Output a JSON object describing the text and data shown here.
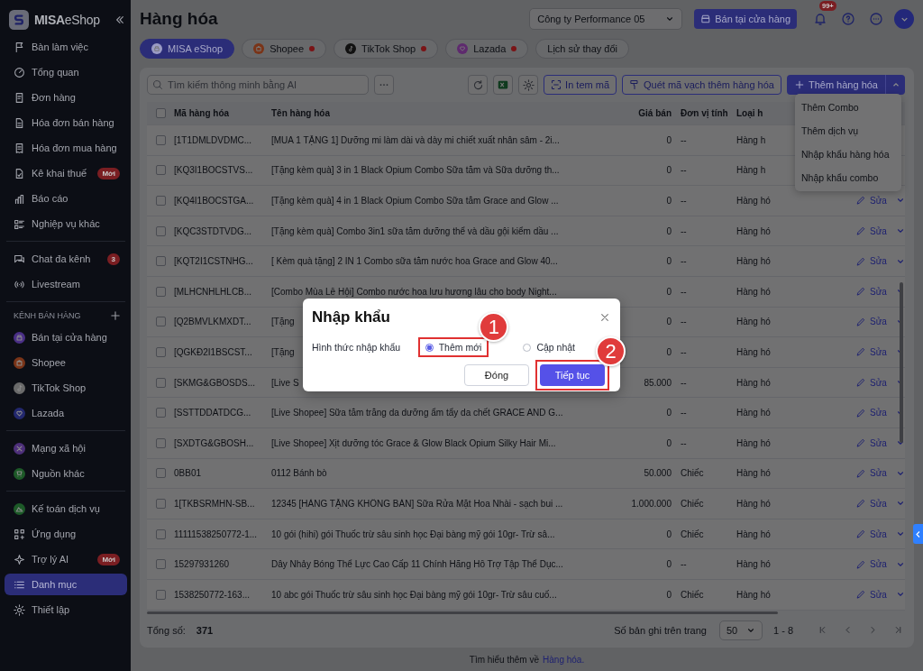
{
  "sidebar": {
    "brand": "MISA",
    "product": "eShop",
    "groups": [
      {
        "items": [
          {
            "label": "Bàn làm việc",
            "selected": false
          },
          {
            "label": "Tổng quan",
            "selected": false
          },
          {
            "label": "Đơn hàng",
            "selected": false
          },
          {
            "label": "Hóa đơn bán hàng",
            "selected": false
          },
          {
            "label": "Hóa đơn mua hàng",
            "selected": false
          },
          {
            "label": "Kê khai thuế",
            "badge": "Mới",
            "selected": false
          },
          {
            "label": "Báo cáo",
            "selected": false
          },
          {
            "label": "Nghiệp vụ khác",
            "selected": false
          }
        ]
      },
      {
        "items": [
          {
            "label": "Chat đa kênh",
            "badge": "3",
            "selected": false
          },
          {
            "label": "Livestream",
            "selected": false
          }
        ]
      },
      {
        "title": "KÊNH BÁN HÀNG",
        "items": [
          {
            "label": "Bán tại cửa hàng",
            "color": "#4a2f86",
            "selected": false
          },
          {
            "label": "Shopee",
            "color": "#7a3418",
            "selected": false
          },
          {
            "label": "TikTok Shop",
            "color": "#6a6a6a",
            "selected": false
          },
          {
            "label": "Lazada",
            "color": "#23286e",
            "selected": false
          }
        ]
      },
      {
        "items": [
          {
            "label": "Mạng xã hội",
            "color": "#4d2f7a",
            "selected": false
          },
          {
            "label": "Nguồn khác",
            "color": "#1d5a28",
            "selected": false
          }
        ]
      },
      {
        "items": [
          {
            "label": "Kế toán dịch vụ",
            "color": "#1d5a28",
            "selected": false
          },
          {
            "label": "Ứng dụng",
            "selected": false
          },
          {
            "label": "Trợ lý AI",
            "badge": "Mới",
            "selected": false
          },
          {
            "label": "Danh mục",
            "selected": true
          },
          {
            "label": "Thiết lập",
            "selected": false
          }
        ]
      }
    ]
  },
  "header": {
    "title": "Hàng hóa",
    "company": "Công ty Performance 05",
    "store_button": "Bán tại cửa hàng",
    "notifications": "99+"
  },
  "tabs": [
    {
      "label": "MISA eShop",
      "color": "#9a9bc4",
      "selected": true,
      "alert": false
    },
    {
      "label": "Shopee",
      "color": "#7a3418",
      "selected": false,
      "alert": true
    },
    {
      "label": "TikTok Shop",
      "color": "#111111",
      "selected": false,
      "alert": true
    },
    {
      "label": "Lazada",
      "color": "#5e2a6e",
      "selected": false,
      "alert": true
    },
    {
      "label": "Lịch sử thay đổi",
      "selected": false,
      "alert": false
    }
  ],
  "toolbar": {
    "search_placeholder": "Tìm kiếm thông minh bằng AI",
    "print_button": "In tem mã",
    "scan_button": "Quét mã vạch thêm hàng hóa",
    "add_button": "Thêm hàng hóa"
  },
  "add_menu": [
    "Thêm Combo",
    "Thêm dịch vụ",
    "Nhập khẩu hàng hóa",
    "Nhập khẩu combo"
  ],
  "table": {
    "all_checked": false,
    "columns": [
      "Mã hàng hóa",
      "Tên hàng hóa",
      "Giá bán",
      "Đơn vị tính",
      "Loại h"
    ],
    "rows": [
      {
        "checked": false,
        "code": "[1T1DMLDVDMC...",
        "name": "[MUA 1 TẶNG 1] Dưỡng mi làm dài và dày mi chiết xuất nhân sâm - 2i...",
        "price": "0",
        "unit": "--",
        "type": "Hàng h"
      },
      {
        "checked": false,
        "code": "[KQ3I1BOCSTVS...",
        "name": "[Tặng kèm quà] 3 in 1 Black Opium Combo Sữa tắm và Sữa dưỡng th...",
        "price": "0",
        "unit": "--",
        "type": "Hàng h"
      },
      {
        "checked": false,
        "code": "[KQ4I1BOCSTGA...",
        "name": "[Tặng kèm quà] 4 in 1 Black Opium Combo Sữa tắm Grace and Glow ...",
        "price": "0",
        "unit": "--",
        "type": "Hàng hó",
        "action": "Sửa"
      },
      {
        "checked": false,
        "code": "[KQC3STDTVDG...",
        "name": "[Tặng kèm quà] Combo 3in1 sữa tắm dưỡng thể và dầu gội kiểm dầu ...",
        "price": "0",
        "unit": "--",
        "type": "Hàng hó",
        "action": "Sửa"
      },
      {
        "checked": false,
        "code": "[KQT2I1CSTNHG...",
        "name": "[ Kèm quà tặng] 2 IN 1 Combo sữa tắm nước hoa Grace and Glow 40...",
        "price": "0",
        "unit": "--",
        "type": "Hàng hó",
        "action": "Sửa"
      },
      {
        "checked": false,
        "code": "[MLHCNHLHLCB...",
        "name": "[Combo Mùa Lễ Hội] Combo nước hoa lưu hương lâu cho body Night...",
        "price": "0",
        "unit": "--",
        "type": "Hàng hó",
        "action": "Sửa"
      },
      {
        "checked": false,
        "code": "[Q2BMVLKMXDT...",
        "name": "[Tặng",
        "price": "0",
        "unit": "--",
        "type": "Hàng hó",
        "action": "Sửa"
      },
      {
        "checked": false,
        "code": "[QGKĐ2I1BSCST...",
        "name": "[Tặng",
        "price": "0",
        "unit": "--",
        "type": "Hàng hó",
        "action": "Sửa"
      },
      {
        "checked": false,
        "code": "[SKMG&GBOSDS...",
        "name": "[Live S",
        "price": "85.000",
        "unit": "--",
        "type": "Hàng hó",
        "action": "Sửa"
      },
      {
        "checked": false,
        "code": "[SSTTDDATDCG...",
        "name": "[Live Shopee] Sữa tắm trắng da dưỡng ẩm tẩy da chết GRACE AND G...",
        "price": "0",
        "unit": "--",
        "type": "Hàng hó",
        "action": "Sửa"
      },
      {
        "checked": false,
        "code": "[SXDTG&GBOSH...",
        "name": "[Live Shopee] Xịt dưỡng tóc Grace & Glow Black Opium Silky Hair Mi...",
        "price": "0",
        "unit": "--",
        "type": "Hàng hó",
        "action": "Sửa"
      },
      {
        "checked": false,
        "code": "0BB01",
        "name": "0112 Bánh bò",
        "price": "50.000",
        "unit": "Chiếc",
        "type": "Hàng hó",
        "action": "Sửa"
      },
      {
        "checked": false,
        "code": "1[TKBSRMHN-SB...",
        "name": "12345 [HÀNG TẶNG KHÔNG BÁN] Sữa Rửa Mặt Hoa Nhài - sạch bui ...",
        "price": "1.000.000",
        "unit": "Chiếc",
        "type": "Hàng hó",
        "action": "Sửa"
      },
      {
        "checked": false,
        "code": "11111538250772-1...",
        "name": "10 gói (hihi) gói Thuốc trừ sâu sinh học Đại bàng mỹ gói 10gr- Trừ sâ...",
        "price": "0",
        "unit": "Chiếc",
        "type": "Hàng hó",
        "action": "Sửa"
      },
      {
        "checked": false,
        "code": "15297931260",
        "name": "Dây Nhảy Bóng Thể Lực Cao Cấp 11 Chính Hãng Hỗ Trợ Tập Thể Dục...",
        "price": "0",
        "unit": "--",
        "type": "Hàng hó",
        "action": "Sửa"
      },
      {
        "checked": false,
        "code": "1538250772-163...",
        "name": "10 abc gói Thuốc trừ sâu sinh học Đại bàng mỹ gói 10gr- Trừ sâu cuố...",
        "price": "0",
        "unit": "Chiếc",
        "type": "Hàng hó",
        "action": "Sửa"
      }
    ]
  },
  "footer": {
    "total_label": "Tổng số:",
    "total": "371",
    "per_page_label": "Số bản ghi trên trang",
    "per_page": "50",
    "range": "1 - 8"
  },
  "help": {
    "text": "Tìm hiểu thêm về",
    "link": "Hàng hóa."
  },
  "import_dialog": {
    "title": "Nhập khẩu",
    "label": "Hình thức nhập khẩu",
    "options": [
      {
        "label": "Thêm mới",
        "selected": true,
        "step": "1"
      },
      {
        "label": "Cập nhật",
        "selected": false
      }
    ],
    "buttons": [
      {
        "label": "Đóng",
        "kind": "secondary"
      },
      {
        "label": "Tiếp tục",
        "kind": "primary",
        "step": "2"
      }
    ]
  }
}
